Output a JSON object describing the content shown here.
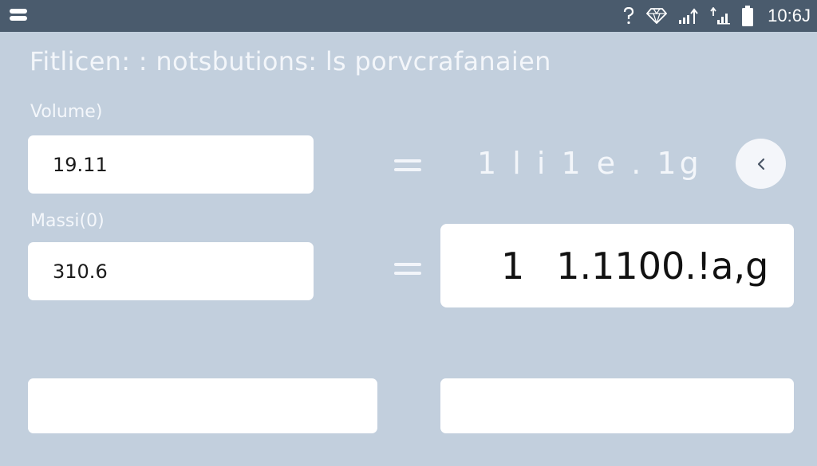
{
  "status_bar": {
    "time": "10:6J",
    "icons": [
      "menu-icon",
      "help-icon",
      "diamond-icon",
      "signal-icon",
      "signal-data-icon",
      "battery-icon"
    ]
  },
  "page": {
    "title": "Fitlicen:  : notsbutions: ls porvcrafanaien"
  },
  "volume": {
    "label": "Volume)",
    "value": "19.11"
  },
  "mass": {
    "label": "Massi(0)",
    "value": "310.6"
  },
  "result": {
    "plain": "1 l i 1 e . 1g",
    "prefix": "1",
    "main": "1.1100.!a,g"
  },
  "colors": {
    "background": "#c2cfdd",
    "status_bar": "#4a5b6d",
    "card": "#ffffff",
    "text_light": "#f3f6fa",
    "text_dark": "#1b1b1b"
  }
}
